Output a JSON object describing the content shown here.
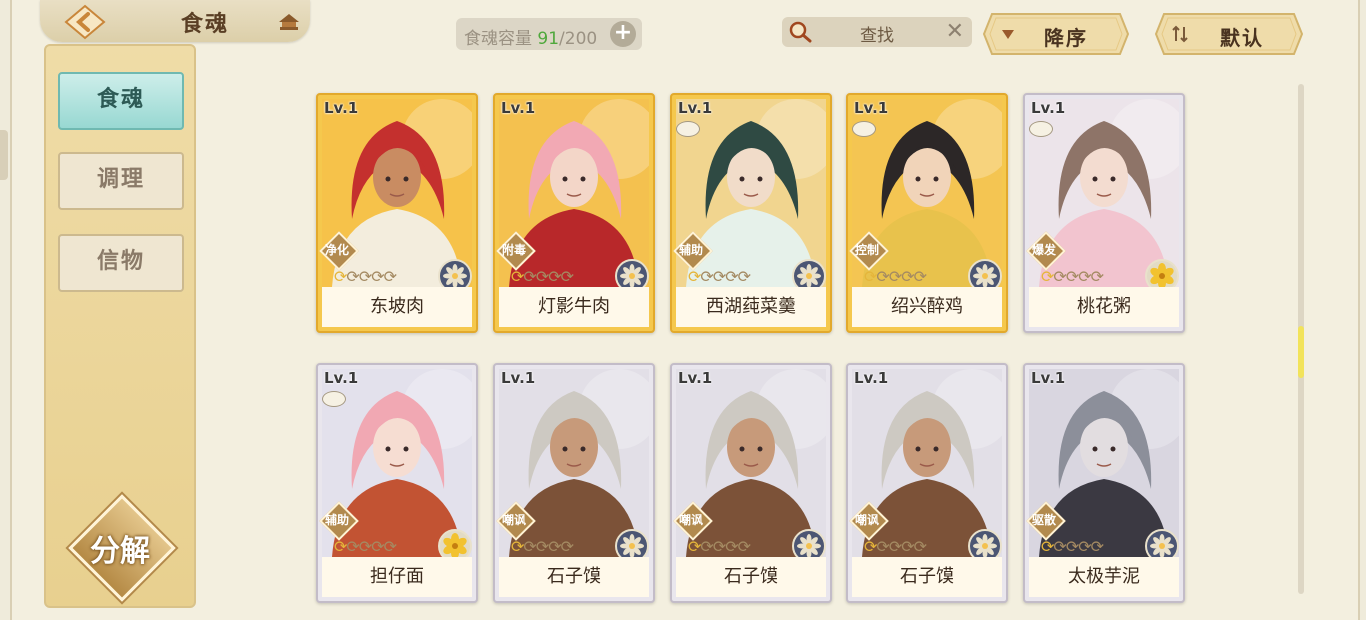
{
  "header": {
    "title": "食魂",
    "capacity_label": "食魂容量",
    "capacity_current": "91",
    "capacity_max": "/200",
    "add_label": "+",
    "search_label": "查找",
    "clear_label": "✕",
    "sort_desc_label": "降序",
    "sort_default_label": "默认"
  },
  "sidebar": {
    "items": [
      {
        "label": "食魂"
      },
      {
        "label": "调理"
      },
      {
        "label": "信物"
      }
    ],
    "decompose_label": "分解"
  },
  "cards": [
    {
      "level": "Lv.1",
      "role": "净化",
      "name": "东坡肉",
      "stars_on": 1,
      "stars_total": 5,
      "rarity": "gold",
      "element": "blue-flower",
      "hair": "#c4302e",
      "skin": "#c98c62",
      "bg": "#f6c24a",
      "cloth": "#f3eddd"
    },
    {
      "level": "Lv.1",
      "role": "附毒",
      "name": "灯影牛肉",
      "stars_on": 1,
      "stars_total": 5,
      "rarity": "gold",
      "element": "blue-flower",
      "hair": "#f2a9b4",
      "skin": "#f3d6c8",
      "bg": "#f4c14f",
      "cloth": "#b8282a"
    },
    {
      "level": "Lv.1",
      "role": "辅助",
      "name": "西湖莼菜羹",
      "stars_on": 1,
      "stars_total": 5,
      "rarity": "gold",
      "element": "blue-flower",
      "hair": "#2f4a43",
      "skin": "#f1dcc9",
      "bg": "#f1d58f",
      "cloth": "#e6f1ea"
    },
    {
      "level": "Lv.1",
      "role": "控制",
      "name": "绍兴醉鸡",
      "stars_on": 1,
      "stars_total": 5,
      "rarity": "gold",
      "element": "blue-flower",
      "hair": "#2c2727",
      "skin": "#f1d4b9",
      "bg": "#f4c552",
      "cloth": "#e8c24c"
    },
    {
      "level": "Lv.1",
      "role": "爆发",
      "name": "桃花粥",
      "stars_on": 1,
      "stars_total": 5,
      "rarity": "silver",
      "element": "yellow-flower",
      "hair": "#8e7468",
      "skin": "#f3dcd0",
      "bg": "#ece4ea",
      "cloth": "#f2c4cf"
    },
    {
      "level": "Lv.1",
      "role": "辅助",
      "name": "担仔面",
      "stars_on": 1,
      "stars_total": 5,
      "rarity": "silver",
      "element": "yellow-flower",
      "hair": "#f1a8b3",
      "skin": "#f6ddd2",
      "bg": "#e3e1ec",
      "cloth": "#c25333"
    },
    {
      "level": "Lv.1",
      "role": "嘲讽",
      "name": "石子馍",
      "stars_on": 1,
      "stars_total": 5,
      "rarity": "silver",
      "element": "blue-flower",
      "hair": "#cdc9c2",
      "skin": "#c79a7a",
      "bg": "#e2dfe7",
      "cloth": "#7c5238"
    },
    {
      "level": "Lv.1",
      "role": "嘲讽",
      "name": "石子馍",
      "stars_on": 1,
      "stars_total": 5,
      "rarity": "silver",
      "element": "blue-flower",
      "hair": "#cdc9c2",
      "skin": "#c79a7a",
      "bg": "#e2dfe7",
      "cloth": "#7c5238"
    },
    {
      "level": "Lv.1",
      "role": "嘲讽",
      "name": "石子馍",
      "stars_on": 1,
      "stars_total": 5,
      "rarity": "silver",
      "element": "blue-flower",
      "hair": "#cdc9c2",
      "skin": "#c79a7a",
      "bg": "#e2dfe7",
      "cloth": "#7c5238"
    },
    {
      "level": "Lv.1",
      "role": "驱散",
      "name": "太极芋泥",
      "stars_on": 1,
      "stars_total": 5,
      "rarity": "silver",
      "element": "blue-flower",
      "hair": "#8c8f9a",
      "skin": "#e2dde0",
      "bg": "#d9d6e0",
      "cloth": "#3b3942"
    }
  ]
}
